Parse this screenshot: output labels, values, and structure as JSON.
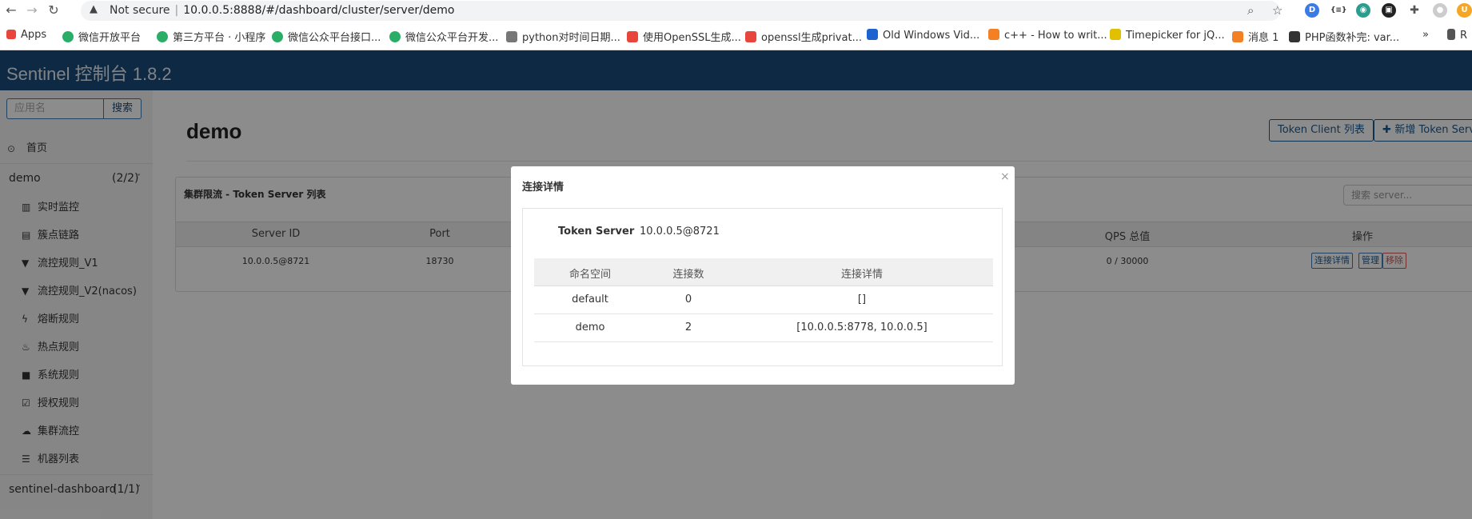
{
  "browser": {
    "security_label": "Not secure",
    "url": "10.0.0.5:8888/#/dashboard/cluster/server/demo",
    "bookmarks": [
      {
        "label": "Apps",
        "color": "#e8453c"
      },
      {
        "label": "微信开放平台",
        "color": "#2aae67"
      },
      {
        "label": "第三方平台 · 小程序",
        "color": "#2aae67"
      },
      {
        "label": "微信公众平台接口...",
        "color": "#2aae67"
      },
      {
        "label": "微信公众平台开发...",
        "color": "#2aae67"
      },
      {
        "label": "python对时间日期...",
        "color": "#555555"
      },
      {
        "label": "使用OpenSSL生成...",
        "color": "#e8453c"
      },
      {
        "label": "openssl生成privat...",
        "color": "#e8453c"
      },
      {
        "label": "Old Windows Vid...",
        "color": "#1e62d0"
      },
      {
        "label": "c++ - How to writ...",
        "color": "#f48024"
      },
      {
        "label": "Timepicker for jQ...",
        "color": "#e0c000"
      },
      {
        "label": "消息 1",
        "color": "#f48024"
      },
      {
        "label": "PHP函数补完: var...",
        "color": "#333333"
      }
    ],
    "bookmarks_more": "»",
    "reading_list": "R"
  },
  "app": {
    "brand": "Sentinel 控制台 1.8.2",
    "header_color": "#1a4c7a"
  },
  "sidebar": {
    "search_placeholder": "应用名",
    "search_button": "搜索",
    "home": "首页",
    "app_group": {
      "name": "demo",
      "count": "(2/2)"
    },
    "items": [
      {
        "label": "实时监控",
        "icon": "bar-chart-icon"
      },
      {
        "label": "簇点链路",
        "icon": "list-icon"
      },
      {
        "label": "流控规则_V1",
        "icon": "filter-icon"
      },
      {
        "label": "流控规则_V2(nacos)",
        "icon": "filter-icon"
      },
      {
        "label": "熔断规则",
        "icon": "bolt-icon"
      },
      {
        "label": "热点规则",
        "icon": "fire-icon"
      },
      {
        "label": "系统规则",
        "icon": "lock-icon"
      },
      {
        "label": "授权规则",
        "icon": "check-square-icon"
      },
      {
        "label": "集群流控",
        "icon": "cloud-icon"
      },
      {
        "label": "机器列表",
        "icon": "list-icon"
      }
    ],
    "app_group_2": {
      "name": "sentinel-dashboard",
      "count": "(1/1)"
    }
  },
  "main": {
    "title": "demo",
    "token_client_button": "Token Client 列表",
    "add_token_server_button": "新增 Token Server",
    "panel_title": "集群限流 - Token Server 列表",
    "search_placeholder": "搜索 server...",
    "columns": [
      "Server ID",
      "Port",
      "QPS 总值",
      "操作"
    ],
    "row": {
      "server_id": "10.0.0.5@8721",
      "port": "18730",
      "qps": "0 / 30000",
      "actions": [
        "连接详情",
        "管理",
        "移除"
      ]
    }
  },
  "modal": {
    "title": "连接详情",
    "close": "×",
    "token_server_label": "Token Server",
    "token_server_value": "10.0.0.5@8721",
    "columns": [
      "命名空间",
      "连接数",
      "连接详情"
    ],
    "rows": [
      {
        "namespace": "default",
        "count": "0",
        "detail": "[]"
      },
      {
        "namespace": "demo",
        "count": "2",
        "detail": "[10.0.0.5:8778, 10.0.0.5]"
      }
    ]
  }
}
